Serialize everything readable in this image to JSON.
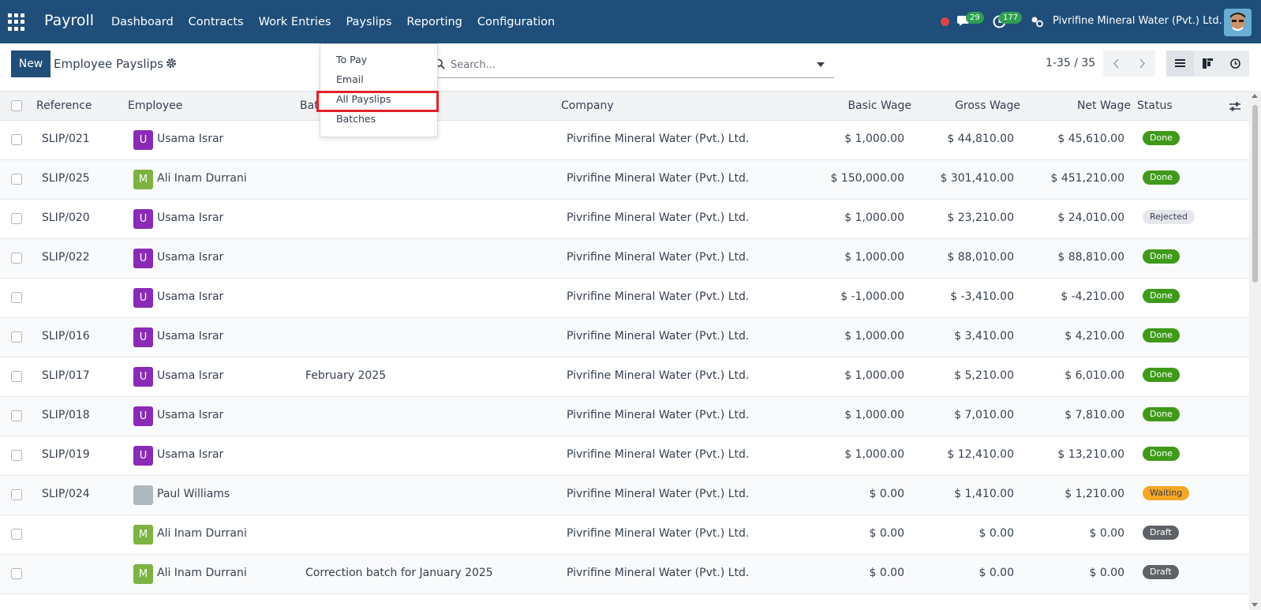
{
  "navbar": {
    "app_name": "Payroll",
    "menu": [
      "Dashboard",
      "Contracts",
      "Work Entries",
      "Payslips",
      "Reporting",
      "Configuration"
    ],
    "messages_count": "29",
    "activities_count": "177",
    "company": "Pivrifine Mineral Water (Pvt.) Ltd."
  },
  "control": {
    "new_label": "New",
    "title": "Employee Payslips",
    "search_placeholder": "Search...",
    "pager": "1-35 / 35"
  },
  "dropdown": {
    "items": [
      "To Pay",
      "Email",
      "All Payslips",
      "Batches"
    ],
    "highlighted": "All Payslips"
  },
  "table": {
    "columns": [
      "Reference",
      "Employee",
      "Bat",
      "Company",
      "Basic Wage",
      "Gross Wage",
      "Net Wage",
      "Status"
    ],
    "rows": [
      {
        "reference": "SLIP/021",
        "initial": "U",
        "employee": "Usama Israr",
        "batch": "",
        "company": "Pivrifine Mineral Water (Pvt.) Ltd.",
        "basic": "$ 1,000.00",
        "gross": "$ 44,810.00",
        "net": "$ 45,610.00",
        "status": "Done"
      },
      {
        "reference": "SLIP/025",
        "initial": "M",
        "employee": "Ali Inam Durrani",
        "batch": "",
        "company": "Pivrifine Mineral Water (Pvt.) Ltd.",
        "basic": "$ 150,000.00",
        "gross": "$ 301,410.00",
        "net": "$ 451,210.00",
        "status": "Done"
      },
      {
        "reference": "SLIP/020",
        "initial": "U",
        "employee": "Usama Israr",
        "batch": "",
        "company": "Pivrifine Mineral Water (Pvt.) Ltd.",
        "basic": "$ 1,000.00",
        "gross": "$ 23,210.00",
        "net": "$ 24,010.00",
        "status": "Rejected"
      },
      {
        "reference": "SLIP/022",
        "initial": "U",
        "employee": "Usama Israr",
        "batch": "",
        "company": "Pivrifine Mineral Water (Pvt.) Ltd.",
        "basic": "$ 1,000.00",
        "gross": "$ 88,010.00",
        "net": "$ 88,810.00",
        "status": "Done"
      },
      {
        "reference": "",
        "initial": "U",
        "employee": "Usama Israr",
        "batch": "",
        "company": "Pivrifine Mineral Water (Pvt.) Ltd.",
        "basic": "$ -1,000.00",
        "gross": "$ -3,410.00",
        "net": "$ -4,210.00",
        "status": "Done"
      },
      {
        "reference": "SLIP/016",
        "initial": "U",
        "employee": "Usama Israr",
        "batch": "",
        "company": "Pivrifine Mineral Water (Pvt.) Ltd.",
        "basic": "$ 1,000.00",
        "gross": "$ 3,410.00",
        "net": "$ 4,210.00",
        "status": "Done"
      },
      {
        "reference": "SLIP/017",
        "initial": "U",
        "employee": "Usama Israr",
        "batch": "February 2025",
        "company": "Pivrifine Mineral Water (Pvt.) Ltd.",
        "basic": "$ 1,000.00",
        "gross": "$ 5,210.00",
        "net": "$ 6,010.00",
        "status": "Done"
      },
      {
        "reference": "SLIP/018",
        "initial": "U",
        "employee": "Usama Israr",
        "batch": "",
        "company": "Pivrifine Mineral Water (Pvt.) Ltd.",
        "basic": "$ 1,000.00",
        "gross": "$ 7,010.00",
        "net": "$ 7,810.00",
        "status": "Done"
      },
      {
        "reference": "SLIP/019",
        "initial": "U",
        "employee": "Usama Israr",
        "batch": "",
        "company": "Pivrifine Mineral Water (Pvt.) Ltd.",
        "basic": "$ 1,000.00",
        "gross": "$ 12,410.00",
        "net": "$ 13,210.00",
        "status": "Done"
      },
      {
        "reference": "SLIP/024",
        "initial": "",
        "employee": "Paul Williams",
        "batch": "",
        "company": "Pivrifine Mineral Water (Pvt.) Ltd.",
        "basic": "$ 0.00",
        "gross": "$ 1,410.00",
        "net": "$ 1,210.00",
        "status": "Waiting"
      },
      {
        "reference": "",
        "initial": "M",
        "employee": "Ali Inam Durrani",
        "batch": "",
        "company": "Pivrifine Mineral Water (Pvt.) Ltd.",
        "basic": "$ 0.00",
        "gross": "$ 0.00",
        "net": "$ 0.00",
        "status": "Draft"
      },
      {
        "reference": "",
        "initial": "M",
        "employee": "Ali Inam Durrani",
        "batch": "Correction batch for January 2025",
        "company": "Pivrifine Mineral Water (Pvt.) Ltd.",
        "basic": "$ 0.00",
        "gross": "$ 0.00",
        "net": "$ 0.00",
        "status": "Draft"
      }
    ]
  },
  "colors": {
    "navbar": "#1f4e7a",
    "avatar_u": "#8a2bb5",
    "avatar_m": "#7cb342",
    "done": "#3f9a1a",
    "waiting": "#f5a623",
    "draft": "#5f6368",
    "highlight": "#e0232b"
  }
}
